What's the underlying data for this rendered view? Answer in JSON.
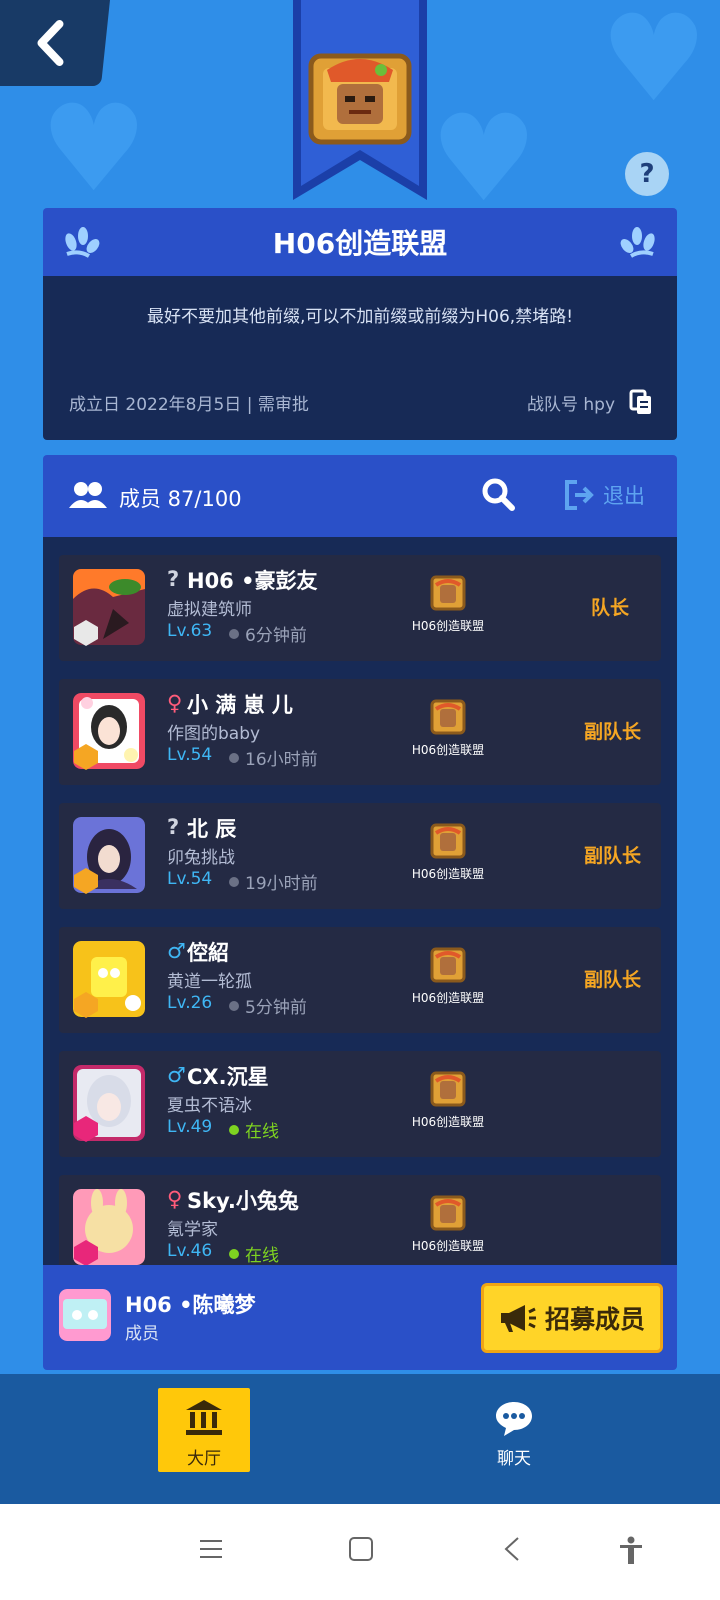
{
  "clan": {
    "name": "H06创造联盟",
    "description": "最好不要加其他前缀,可以不加前缀或前缀为H06,禁堵路!",
    "founded": "成立日 2022年8月5日 | 需审批",
    "team_id": "战队号 hpy"
  },
  "members_header": {
    "count": "成员 87/100",
    "exit_label": "退出"
  },
  "members": [
    {
      "gender": "?",
      "name": "H06 •豪彭友",
      "title": "虚拟建筑师",
      "level": "Lv.63",
      "status": "6分钟前",
      "online": false,
      "clan": "H06创造联盟",
      "role": "队长"
    },
    {
      "gender": "♀",
      "name": "小 满 崽 儿",
      "title": "作图的baby",
      "level": "Lv.54",
      "status": "16小时前",
      "online": false,
      "clan": "H06创造联盟",
      "role": "副队长"
    },
    {
      "gender": "?",
      "name": "北 辰",
      "title": "卯兔挑战",
      "level": "Lv.54",
      "status": "19小时前",
      "online": false,
      "clan": "H06创造联盟",
      "role": "副队长"
    },
    {
      "gender": "♂",
      "name": "倥紹",
      "title": "黄道一轮孤",
      "level": "Lv.26",
      "status": "5分钟前",
      "online": false,
      "clan": "H06创造联盟",
      "role": "副队长"
    },
    {
      "gender": "♂",
      "name": "CX.沉星",
      "title": "夏虫不语冰",
      "level": "Lv.49",
      "status": "在线",
      "online": true,
      "clan": "H06创造联盟",
      "role": ""
    },
    {
      "gender": "♀",
      "name": "Sky.小兔兔",
      "title": "氪学家",
      "level": "Lv.46",
      "status": "在线",
      "online": true,
      "clan": "H06创造联盟",
      "role": ""
    }
  ],
  "self": {
    "name": "H06 •陈曦梦",
    "role": "成员",
    "recruit_label": "招募成员"
  },
  "nav": {
    "hall_label": "大厅",
    "chat_label": "聊天"
  },
  "colors": {
    "background": "#2f8ee8",
    "panel": "#2a50c8",
    "panel_dark": "#172a56",
    "row": "#242a44",
    "accent_yellow": "#ffd428",
    "role_orange": "#f5a623",
    "level_blue": "#3fb6f4",
    "online_green": "#7ed321"
  }
}
